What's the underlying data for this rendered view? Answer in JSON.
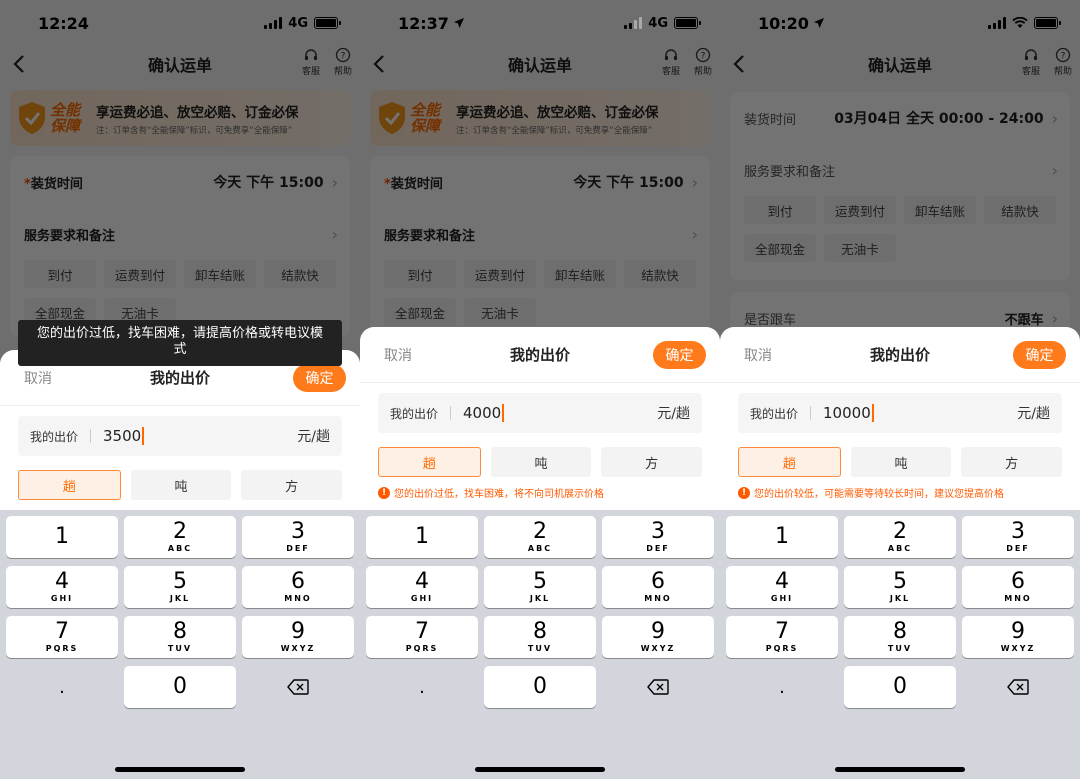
{
  "screens": [
    {
      "status": {
        "time": "12:24",
        "network": "4G"
      },
      "nav": {
        "title": "确认运单",
        "service": "客服",
        "help": "帮助"
      },
      "banner": {
        "logo": "全能保障",
        "main": "享运费必追、放空必赔、订金必保",
        "sub": "注：订单含有“全能保障”标识，可免费享“全能保障”"
      },
      "load_time": {
        "label": "装货时间",
        "value": "今天 下午 15:00"
      },
      "service": {
        "label": "服务要求和备注",
        "tags": [
          "到付",
          "运费到付",
          "卸车结账",
          "结款快",
          "全部现金",
          "无油卡"
        ]
      },
      "toast": "您的出价过低，找车困难，请提高价格或转电议模式",
      "sheet": {
        "cancel": "取消",
        "title": "我的出价",
        "ok": "确定",
        "price_label": "我的出价",
        "price_value": "3500",
        "unit_text": "元/趟",
        "units": [
          "趟",
          "吨",
          "方"
        ],
        "warning": ""
      }
    },
    {
      "status": {
        "time": "12:37",
        "network": "4G"
      },
      "nav": {
        "title": "确认运单",
        "service": "客服",
        "help": "帮助"
      },
      "banner": {
        "logo": "全能保障",
        "main": "享运费必追、放空必赔、订金必保",
        "sub": "注：订单含有“全能保障”标识，可免费享“全能保障”"
      },
      "load_time": {
        "label": "装货时间",
        "value": "今天 下午 15:00"
      },
      "service": {
        "label": "服务要求和备注",
        "tags": [
          "到付",
          "运费到付",
          "卸车结账",
          "结款快",
          "全部现金",
          "无油卡"
        ]
      },
      "sheet": {
        "cancel": "取消",
        "title": "我的出价",
        "ok": "确定",
        "price_label": "我的出价",
        "price_value": "4000",
        "unit_text": "元/趟",
        "units": [
          "趟",
          "吨",
          "方"
        ],
        "warning": "您的出价过低，找车困难，将不向司机展示价格"
      }
    },
    {
      "status": {
        "time": "10:20",
        "network": ""
      },
      "nav": {
        "title": "确认运单",
        "service": "客服",
        "help": "帮助"
      },
      "load_time": {
        "label": "装货时间",
        "value": "03月04日 全天 00:00 - 24:00"
      },
      "service": {
        "label": "服务要求和备注",
        "tags": [
          "到付",
          "运费到付",
          "卸车结账",
          "结款快",
          "全部现金",
          "无油卡"
        ]
      },
      "follow": {
        "label": "是否跟车",
        "value": "不跟车"
      },
      "sheet": {
        "cancel": "取消",
        "title": "我的出价",
        "ok": "确定",
        "price_label": "我的出价",
        "price_value": "10000",
        "unit_text": "元/趟",
        "units": [
          "趟",
          "吨",
          "方"
        ],
        "warning": "您的出价较低，可能需要等待较长时间，建议您提高价格"
      }
    }
  ],
  "keyboard": {
    "keys": [
      {
        "num": "1",
        "sub": ""
      },
      {
        "num": "2",
        "sub": "ABC"
      },
      {
        "num": "3",
        "sub": "DEF"
      },
      {
        "num": "4",
        "sub": "GHI"
      },
      {
        "num": "5",
        "sub": "JKL"
      },
      {
        "num": "6",
        "sub": "MNO"
      },
      {
        "num": "7",
        "sub": "PQRS"
      },
      {
        "num": "8",
        "sub": "TUV"
      },
      {
        "num": "9",
        "sub": "WXYZ"
      },
      {
        "num": ".",
        "sub": ""
      },
      {
        "num": "0",
        "sub": ""
      },
      {
        "num": "delete-icon",
        "sub": ""
      }
    ]
  },
  "colors": {
    "accent": "#ff7a1a",
    "warning": "#ff5a00"
  }
}
